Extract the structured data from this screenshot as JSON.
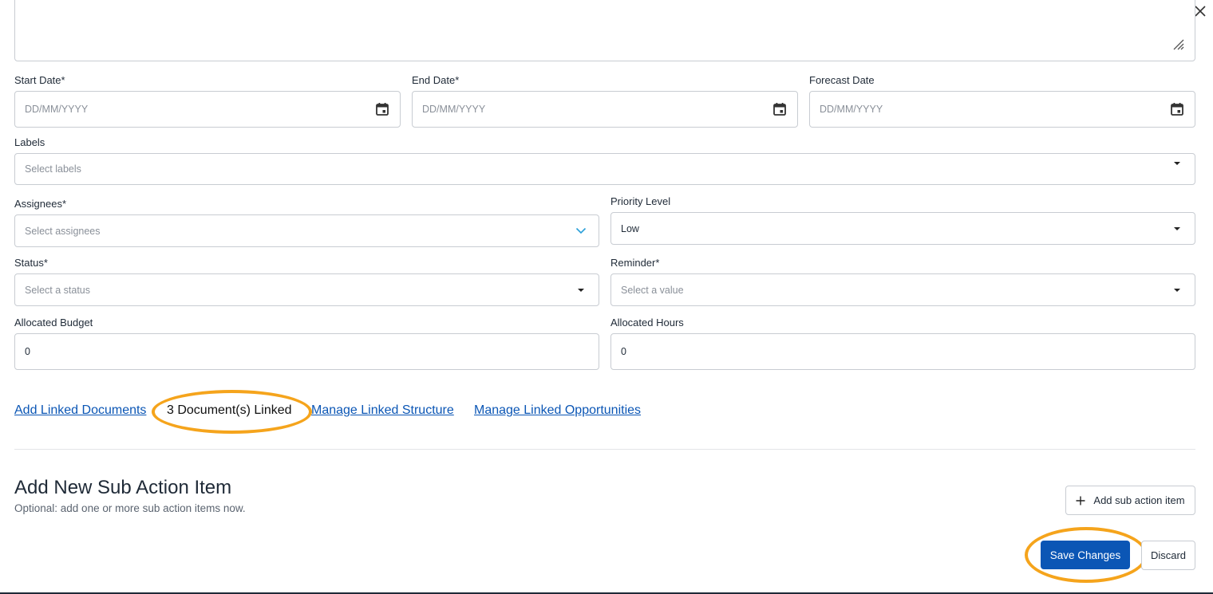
{
  "dialog": {
    "close_icon": "close-icon"
  },
  "dates": {
    "start": {
      "label": "Start Date*",
      "placeholder": "DD/MM/YYYY",
      "icon": "calendar-icon"
    },
    "end": {
      "label": "End Date*",
      "placeholder": "DD/MM/YYYY",
      "icon": "calendar-icon"
    },
    "forecast": {
      "label": "Forecast Date",
      "placeholder": "DD/MM/YYYY",
      "icon": "calendar-icon"
    }
  },
  "labels": {
    "label": "Labels",
    "placeholder": "Select labels"
  },
  "assignees": {
    "label": "Assignees*",
    "placeholder": "Select assignees"
  },
  "priority": {
    "label": "Priority Level",
    "value": "Low"
  },
  "status": {
    "label": "Status*",
    "placeholder": "Select a status"
  },
  "reminder": {
    "label": "Reminder*",
    "placeholder": "Select a value"
  },
  "budget": {
    "label": "Allocated Budget",
    "value": "0"
  },
  "hours": {
    "label": "Allocated Hours",
    "value": "0"
  },
  "links": {
    "add_docs": "Add Linked Documents",
    "docs_linked": "3 Document(s) Linked",
    "manage_structure": "Manage Linked Structure",
    "manage_opportunities": "Manage Linked Opportunities"
  },
  "sub_action": {
    "title": "Add New Sub Action Item",
    "subtitle": "Optional: add one or more sub action items now.",
    "add_button": "Add sub action item",
    "add_icon": "plus-icon"
  },
  "footer": {
    "save_label": "Save Changes",
    "discard_label": "Discard"
  },
  "colors": {
    "accent": "#0b56b5",
    "highlight": "#f5a41c",
    "border": "#c8ccd2"
  }
}
